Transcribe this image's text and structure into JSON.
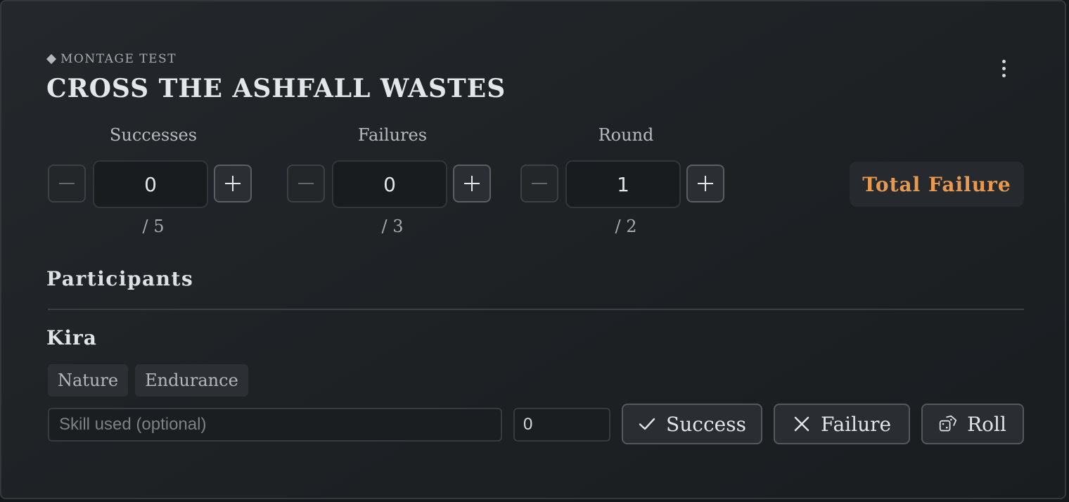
{
  "card": {
    "eyebrow": "MONTAGE TEST",
    "title": "CROSS THE ASHFALL WASTES",
    "menu_icon": "more-vertical-icon"
  },
  "counters": [
    {
      "label": "Successes",
      "value": "0",
      "max": "/ 5"
    },
    {
      "label": "Failures",
      "value": "0",
      "max": "/ 3"
    },
    {
      "label": "Round",
      "value": "1",
      "max": "/ 2"
    }
  ],
  "status": {
    "text": "Total Failure",
    "color": "#e79a4f"
  },
  "participants": {
    "heading": "Participants",
    "items": [
      {
        "name": "Kira",
        "skills": [
          "Nature",
          "Endurance"
        ],
        "skill_placeholder": "Skill used (optional)",
        "skill_value": "",
        "roll_value": "0",
        "success_label": "Success",
        "failure_label": "Failure",
        "roll_label": "Roll"
      }
    ]
  }
}
